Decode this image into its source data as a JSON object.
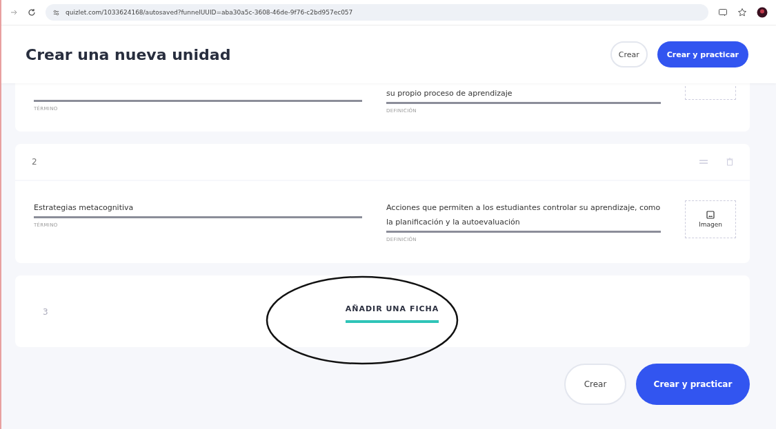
{
  "browser": {
    "url": "quizlet.com/1033624168/autosaved?funnelUUID=aba30a5c-3608-46de-9f76-c2bd957ec057"
  },
  "header": {
    "title": "Crear una nueva unidad",
    "buttons": [
      {
        "label": "Crear",
        "kind": "secondary"
      },
      {
        "label": "Crear y practicar",
        "kind": "primary"
      }
    ]
  },
  "cards": [
    {
      "term_label": "TÉRMINO",
      "definition": "su propio proceso de aprendizaje",
      "definition_label": "DEFINICIÓN"
    },
    {
      "number": "2",
      "term": "Estrategias metacognitiva",
      "term_label": "TÉRMINO",
      "definition": "Acciones que permiten a los estudiantes controlar su aprendizaje, como la planificación y la autoevaluación",
      "definition_label": "DEFINICIÓN",
      "image_label": "Imagen"
    }
  ],
  "add_card": {
    "number": "3",
    "label": "AÑADIR UNA FICHA"
  },
  "footer_buttons": [
    {
      "label": "Crear",
      "kind": "secondary"
    },
    {
      "label": "Crear y practicar",
      "kind": "primary"
    }
  ]
}
